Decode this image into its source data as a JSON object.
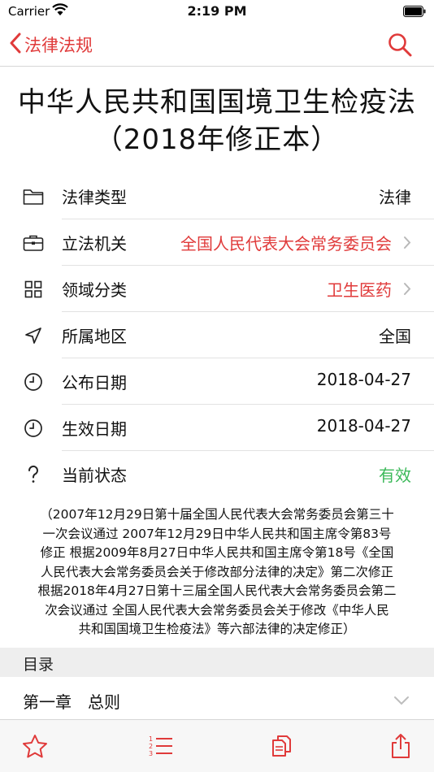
{
  "status_bar": {
    "carrier": "Carrier",
    "time": "2:19 PM"
  },
  "nav": {
    "back_label": "法律法规"
  },
  "title": "中华人民共和国国境卫生检疫法（2018年修正本）",
  "info_rows": [
    {
      "icon": "folder-icon",
      "label": "法律类型",
      "value": "法律"
    },
    {
      "icon": "briefcase-icon",
      "label": "立法机关",
      "value": "全国人民代表大会常务委员会"
    },
    {
      "icon": "grid-icon",
      "label": "领域分类",
      "value": "卫生医药"
    },
    {
      "icon": "location-arrow-icon",
      "label": "所属地区",
      "value": "全国"
    },
    {
      "icon": "clock-icon",
      "label": "公布日期",
      "value": "2018-04-27"
    },
    {
      "icon": "clock-icon",
      "label": "生效日期",
      "value": "2018-04-27"
    },
    {
      "icon": "question-icon",
      "label": "当前状态",
      "value": "有效"
    }
  ],
  "description_lines": [
    "（2007年12月29日第十届全国人民代表大会常务委员会第三十",
    "一次会议通过  2007年12月29日中华人民共和国主席令第83号",
    "修正  根据2009年8月27日中华人民共和国主席令第18号《全国",
    "人民代表大会常务委员会关于修改部分法律的决定》第二次修正",
    "根据2018年4月27日第十三届全国人民代表大会常务委员会第二",
    "次会议通过   全国人民代表大会常务委员会关于修改《中华人民",
    "共和国国境卫生检疫法》等六部法律的决定修正）"
  ],
  "toc": {
    "header": "目录",
    "chapters": [
      "第一章　总则"
    ]
  },
  "colors": {
    "accent": "#e03a3a",
    "status_valid": "#3cb95a"
  },
  "tab_bar": {
    "icons": [
      "star-icon",
      "numbered-list-icon",
      "copy-icon",
      "share-icon"
    ]
  }
}
